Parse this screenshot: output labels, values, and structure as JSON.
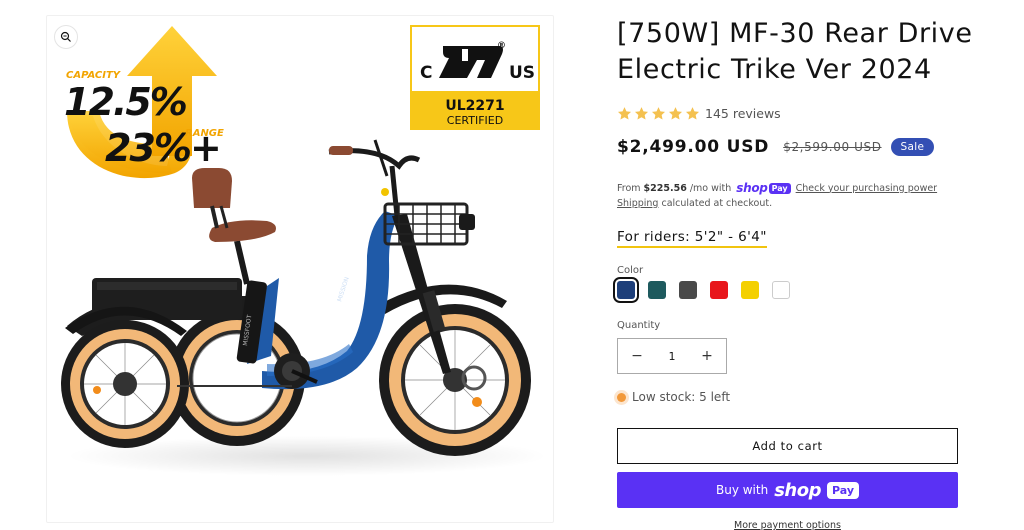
{
  "product": {
    "title_line1": "[750W] MF-30 Rear Drive",
    "title_line2": "Electric Trike Ver 2024",
    "reviews_text": "145 reviews",
    "rating": 5,
    "price": "$2,499.00 USD",
    "compare_price": "$2,599.00 USD",
    "sale_badge": "Sale"
  },
  "installments": {
    "prefix": "From",
    "amount": "$225.56",
    "suffix": "/mo with",
    "shop_word": "shop",
    "pay_word": "Pay",
    "link": "Check your purchasing power"
  },
  "shipping": {
    "link": "Shipping",
    "text": "calculated at checkout."
  },
  "riders": "For riders: 5'2\" - 6'4\"",
  "color": {
    "label": "Color",
    "swatches": [
      "#1e3f7a",
      "#1e5a5e",
      "#4a4a4a",
      "#e8161b",
      "#f4d000",
      "#ffffff"
    ]
  },
  "quantity": {
    "label": "Quantity",
    "value": "1",
    "minus": "−",
    "plus": "+"
  },
  "stock": "Low stock: 5 left",
  "buttons": {
    "add_to_cart": "Add to cart",
    "buy_with": "Buy with",
    "shop_word": "shop",
    "pay_word": "Pay",
    "more_options": "More payment options"
  },
  "media": {
    "capacity_label": "CAPACITY",
    "capacity_value": "12.5%",
    "range_value": "23%+",
    "range_label": "RANGE",
    "cert_c": "C",
    "cert_us": "US",
    "cert_r": "®",
    "cert_code": "UL2271",
    "cert_word": "CERTIFIED",
    "frame_brand": "Foot",
    "frame_brand_small": "MISSION"
  },
  "colors": {
    "accent_purple": "#5a31f4",
    "sale_blue": "#334fb4",
    "star_gold": "#f4c150",
    "frame_blue": "#1f5aa8",
    "tire_tan": "#f2b878",
    "cert_yellow": "#f7c718"
  }
}
